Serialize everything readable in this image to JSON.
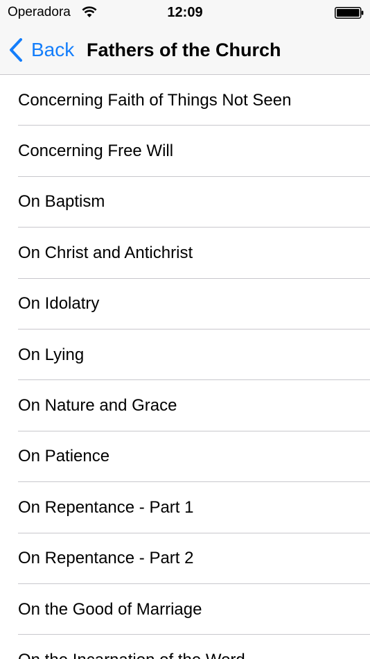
{
  "status_bar": {
    "carrier": "Operadora",
    "time": "12:09",
    "icons": [
      "wifi-icon",
      "battery-icon"
    ]
  },
  "nav": {
    "back_label": "Back",
    "back_icon": "chevron-left-icon",
    "title": "Fathers of the Church",
    "accent_color": "#147efb"
  },
  "list": {
    "items": [
      {
        "label": "Concerning Faith of Things Not Seen"
      },
      {
        "label": "Concerning Free Will"
      },
      {
        "label": "On Baptism"
      },
      {
        "label": "On Christ and Antichrist"
      },
      {
        "label": "On Idolatry"
      },
      {
        "label": "On Lying"
      },
      {
        "label": "On Nature and Grace"
      },
      {
        "label": "On Patience"
      },
      {
        "label": "On Repentance - Part 1"
      },
      {
        "label": "On Repentance - Part 2"
      },
      {
        "label": "On the Good of Marriage"
      },
      {
        "label": "On the Incarnation of the Word"
      }
    ]
  }
}
